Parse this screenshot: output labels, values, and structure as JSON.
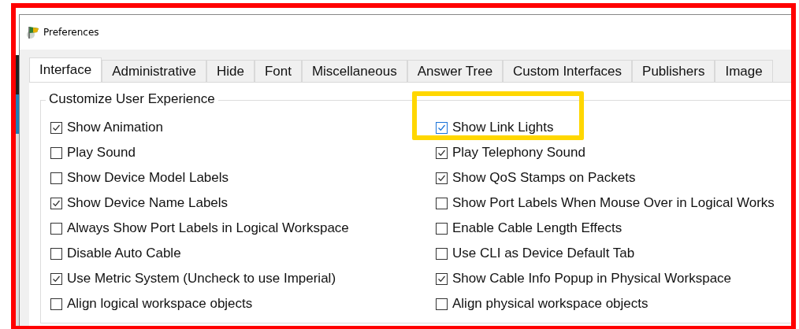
{
  "window": {
    "title": "Preferences"
  },
  "tabs": [
    {
      "label": "Interface",
      "selected": true
    },
    {
      "label": "Administrative",
      "selected": false
    },
    {
      "label": "Hide",
      "selected": false
    },
    {
      "label": "Font",
      "selected": false
    },
    {
      "label": "Miscellaneous",
      "selected": false
    },
    {
      "label": "Answer Tree",
      "selected": false
    },
    {
      "label": "Custom Interfaces",
      "selected": false
    },
    {
      "label": "Publishers",
      "selected": false
    },
    {
      "label": "Image",
      "selected": false
    }
  ],
  "group": {
    "title": "Customize User Experience",
    "left_options": [
      {
        "label": "Show Animation",
        "checked": true,
        "highlighted": false
      },
      {
        "label": "Play Sound",
        "checked": false,
        "highlighted": false
      },
      {
        "label": "Show Device Model Labels",
        "checked": false,
        "highlighted": false
      },
      {
        "label": "Show Device Name Labels",
        "checked": true,
        "highlighted": false
      },
      {
        "label": "Always Show Port Labels in Logical Workspace",
        "checked": false,
        "highlighted": false
      },
      {
        "label": "Disable Auto Cable",
        "checked": false,
        "highlighted": false
      },
      {
        "label": "Use Metric System (Uncheck to use Imperial)",
        "checked": true,
        "highlighted": false
      },
      {
        "label": "Align logical workspace objects",
        "checked": false,
        "highlighted": false
      }
    ],
    "right_options": [
      {
        "label": "Show Link Lights",
        "checked": true,
        "highlighted": true
      },
      {
        "label": "Play Telephony Sound",
        "checked": true,
        "highlighted": false
      },
      {
        "label": "Show QoS Stamps on Packets",
        "checked": true,
        "highlighted": false
      },
      {
        "label": "Show Port Labels When Mouse Over in Logical Works",
        "checked": false,
        "highlighted": false
      },
      {
        "label": "Enable Cable Length Effects",
        "checked": false,
        "highlighted": false
      },
      {
        "label": "Use CLI as Device Default Tab",
        "checked": false,
        "highlighted": false
      },
      {
        "label": "Show Cable Info Popup in Physical Workspace",
        "checked": true,
        "highlighted": false
      },
      {
        "label": "Align physical workspace objects",
        "checked": false,
        "highlighted": false
      }
    ]
  }
}
